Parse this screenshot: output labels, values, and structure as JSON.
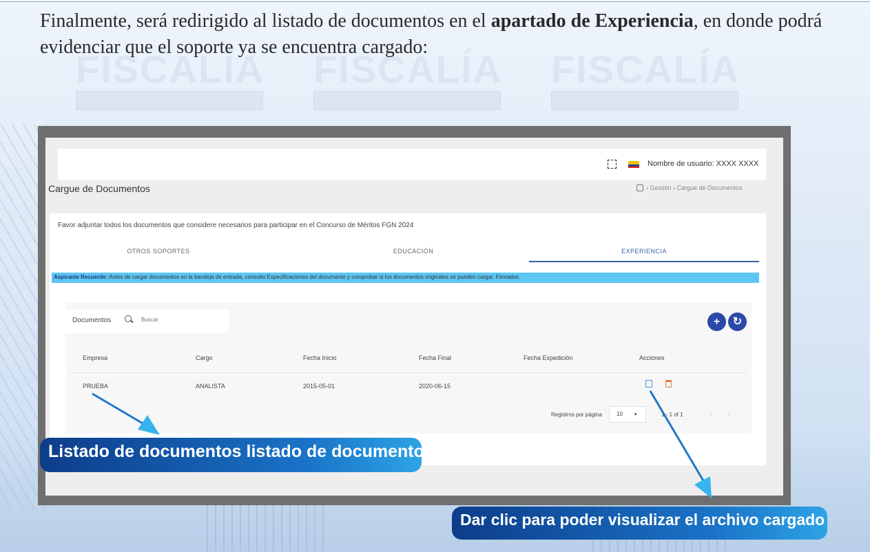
{
  "intro": {
    "text_before": "Finalmente, será redirigido al listado de documentos en el ",
    "bold": "apartado de Experiencia",
    "text_after": ", en donde podrá evidenciar que el soporte ya se encuentra cargado:"
  },
  "watermark": {
    "text": "FISCALÍA"
  },
  "header": {
    "user_label": "Nombre de usuario: XXXX XXXX"
  },
  "page": {
    "title": "Cargue de Documentos",
    "breadcrumb": "› Gestión › Cargue de Documentos"
  },
  "instructions": "Favor adjuntar todos los documentos que considere necesarios para participar en el Concurso de Méritos FGN 2024",
  "tabs": [
    {
      "label": "OTROS SOPORTES"
    },
    {
      "label": "EDUCACIÓN"
    },
    {
      "label": "EXPERIENCIA",
      "active": true
    }
  ],
  "notice": {
    "bold": "Aspirante Recuerde:",
    "text": " Antes de cargar documentos en la bandeja de entrada, consulte Especificaciones del documento y comprobar si los documentos originales se pueden cargar. Firmados."
  },
  "table": {
    "title": "Documentos",
    "search_placeholder": "Buscar",
    "add_symbol": "+",
    "refresh_symbol": "↻",
    "columns": [
      "Empresa",
      "Cargo",
      "Fecha Inicio",
      "Fecha Final",
      "Fecha Expedición",
      "Acciones"
    ],
    "rows": [
      {
        "empresa": "PRUEBA",
        "cargo": "ANALISTA",
        "fecha_inicio": "2015-05-01",
        "fecha_final": "2020-06-15",
        "fecha_expedicion": ""
      }
    ],
    "actions_icons": [
      "edit-icon",
      "trash-icon"
    ]
  },
  "pagination": {
    "label": "Registros por página",
    "per_page": "10",
    "caret": "▾",
    "range": "1 - 1 of 1",
    "prev": "‹",
    "next": "›"
  },
  "callouts": {
    "list": "Listado de documentos listado de documentos",
    "view": "Dar clic para poder visualizar el archivo cargado"
  },
  "colors": {
    "primary": "#2c48a8",
    "notice": "#5dc6f3",
    "callout": "#1a73c7",
    "edit": "#4a90d9",
    "delete": "#e0823d"
  }
}
